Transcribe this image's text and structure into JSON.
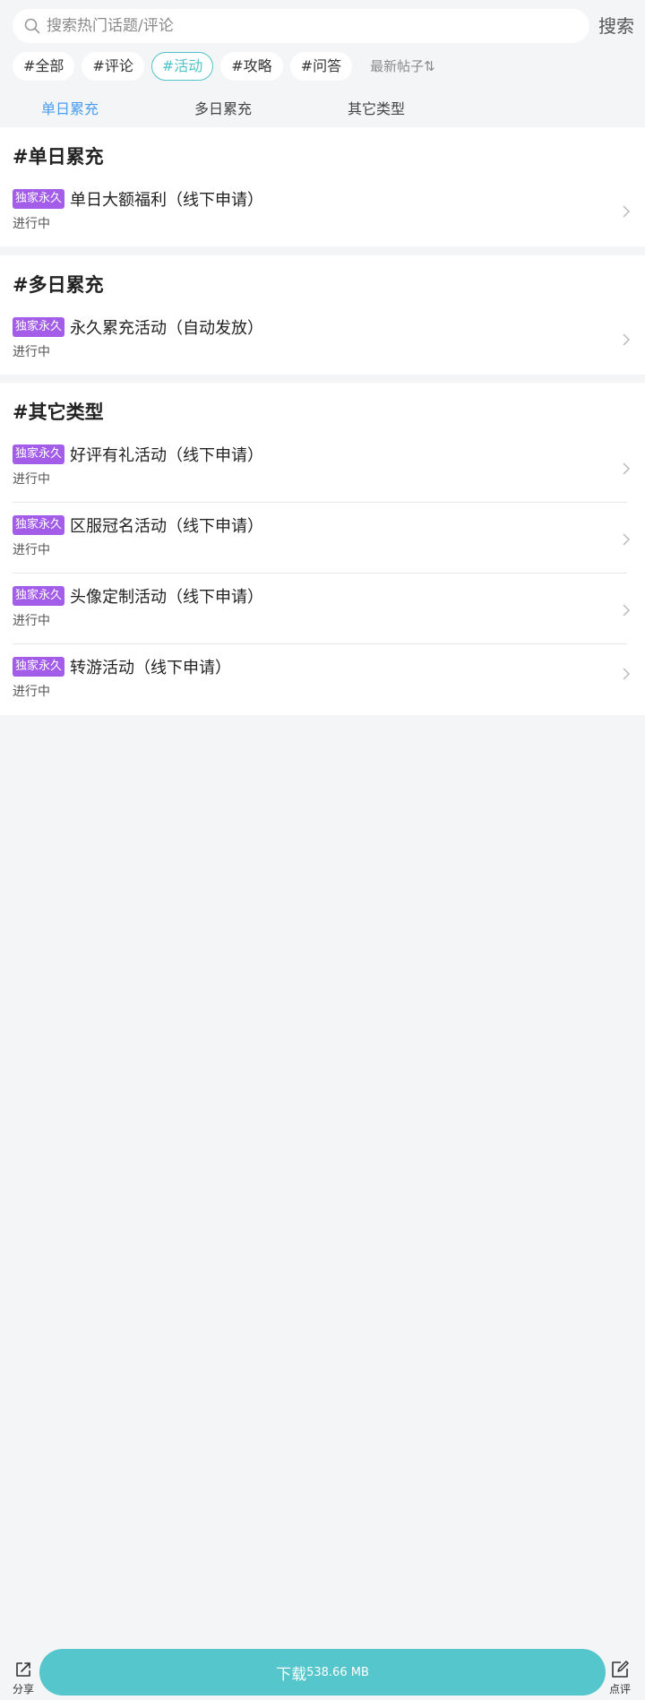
{
  "search": {
    "placeholder": "搜索热门话题/评论",
    "button_label": "搜索"
  },
  "chips": [
    {
      "label": "#全部",
      "active": false
    },
    {
      "label": "#评论",
      "active": false
    },
    {
      "label": "#活动",
      "active": true
    },
    {
      "label": "#攻略",
      "active": false
    },
    {
      "label": "#问答",
      "active": false
    }
  ],
  "sort_label": "最新帖子⇅",
  "tabs": [
    {
      "label": "单日累充",
      "active": true
    },
    {
      "label": "多日累充",
      "active": false
    },
    {
      "label": "其它类型",
      "active": false
    }
  ],
  "sections": [
    {
      "title": "#单日累充",
      "items": [
        {
          "badge": "独家永久",
          "title": "单日大额福利（线下申请）",
          "status": "进行中"
        }
      ]
    },
    {
      "title": "#多日累充",
      "items": [
        {
          "badge": "独家永久",
          "title": "永久累充活动（自动发放）",
          "status": "进行中"
        }
      ]
    },
    {
      "title": "#其它类型",
      "items": [
        {
          "badge": "独家永久",
          "title": "好评有礼活动（线下申请）",
          "status": "进行中"
        },
        {
          "badge": "独家永久",
          "title": "区服冠名活动（线下申请）",
          "status": "进行中"
        },
        {
          "badge": "独家永久",
          "title": "头像定制活动（线下申请）",
          "status": "进行中"
        },
        {
          "badge": "独家永久",
          "title": "转游活动（线下申请）",
          "status": "进行中"
        }
      ]
    }
  ],
  "bottom": {
    "share_label": "分享",
    "download_label": "下载",
    "download_size": "538.66 MB",
    "review_label": "点评"
  },
  "colors": {
    "accent_teal": "#55c6cb",
    "tab_active": "#4a9df0",
    "badge_purple": "#a35de8",
    "page_bg": "#f4f5f7"
  }
}
